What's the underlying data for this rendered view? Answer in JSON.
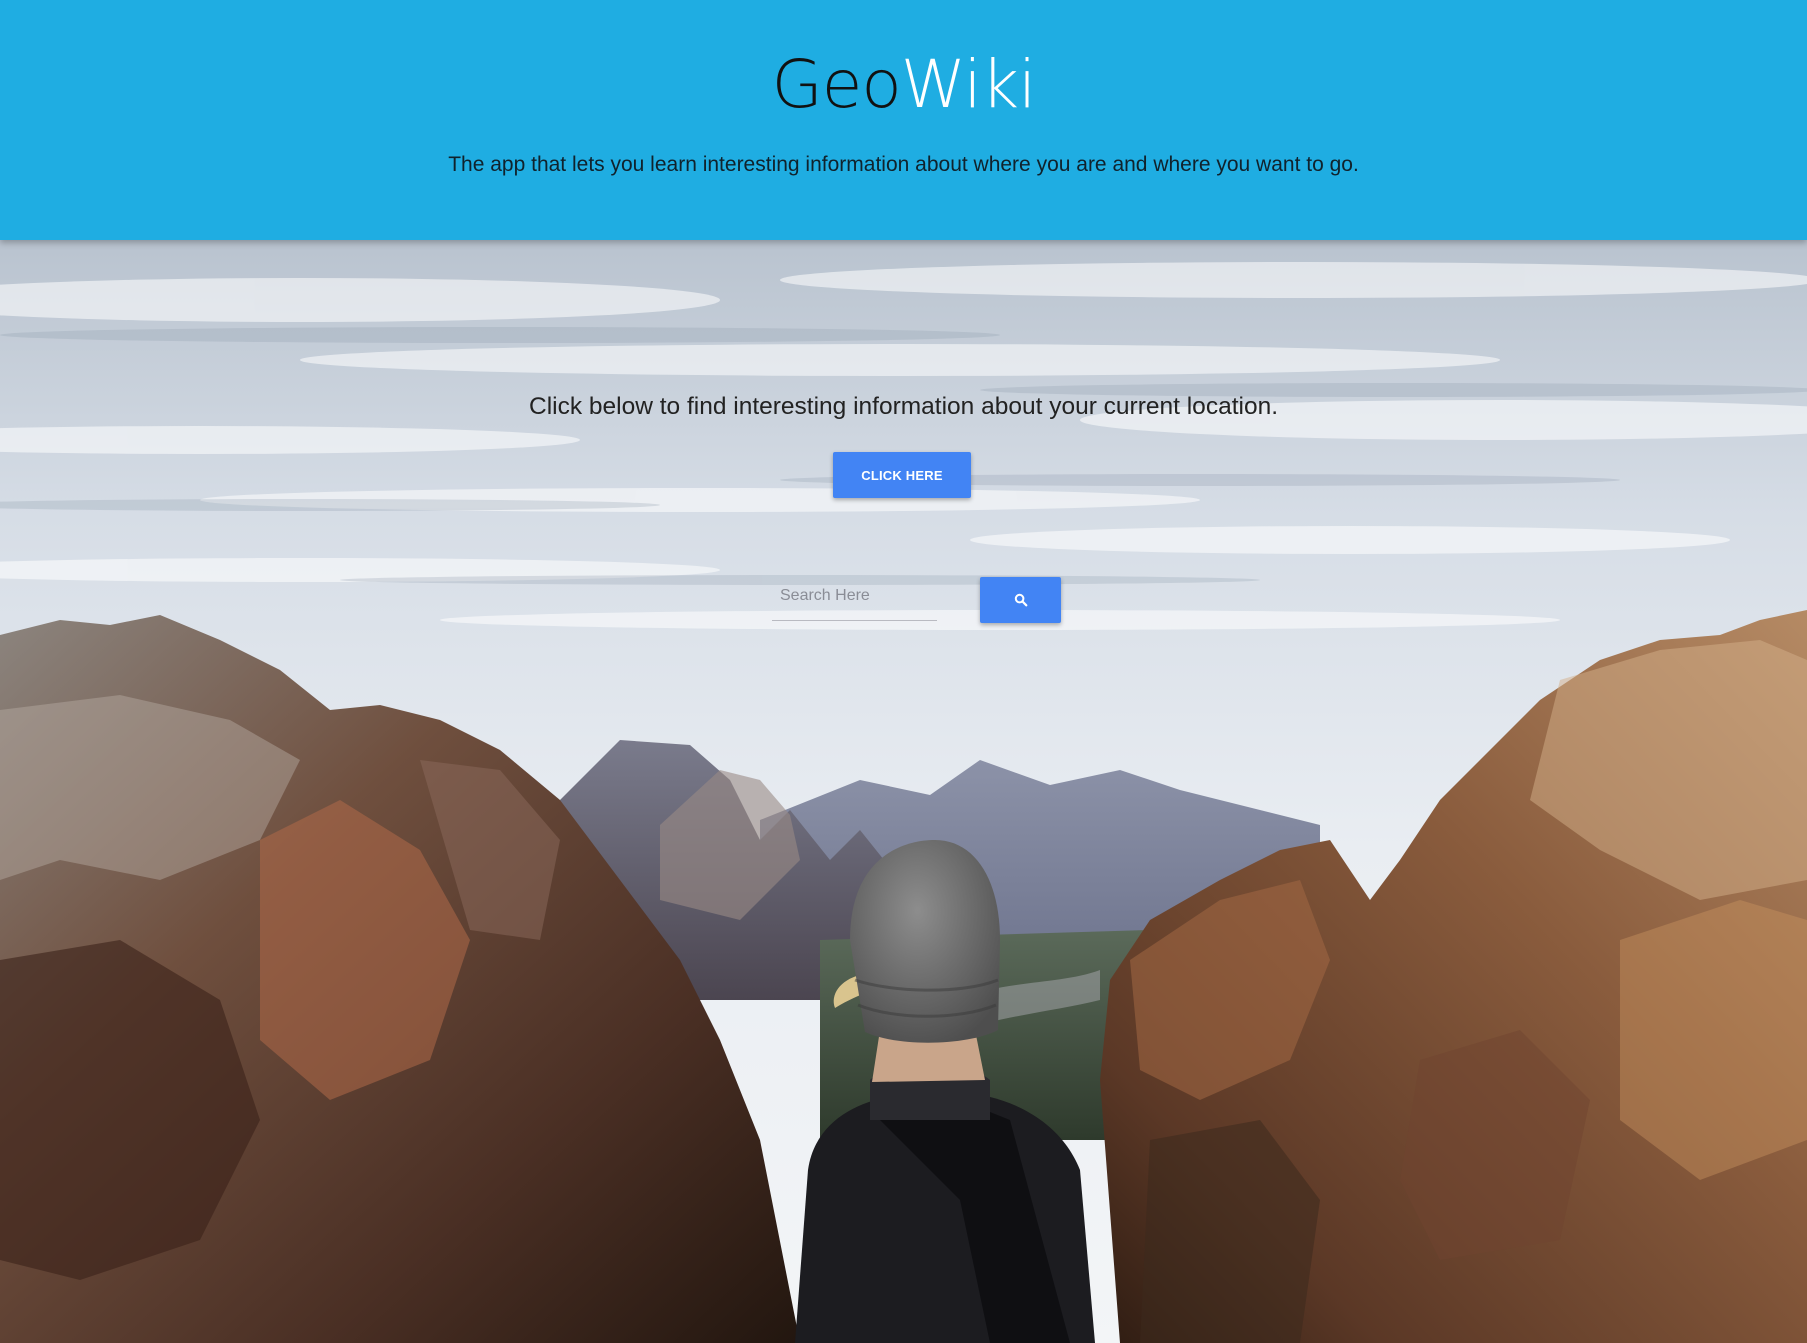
{
  "header": {
    "title_part1": "Geo",
    "title_part2": "Wiki",
    "tagline": "The app that lets you learn interesting information about where you are and where you want to go."
  },
  "main": {
    "prompt": "Click below to find interesting information about your current location.",
    "click_button_label": "CLICK HERE",
    "search": {
      "placeholder": "Search Here",
      "value": "",
      "button_icon": "search-icon"
    }
  },
  "background": {
    "subject": "hiker in beanie overlooking canyon"
  },
  "colors": {
    "header_bg": "#1fade2",
    "button_bg": "#4284f4",
    "title_dark": "#111111",
    "title_light": "#ffffff"
  }
}
